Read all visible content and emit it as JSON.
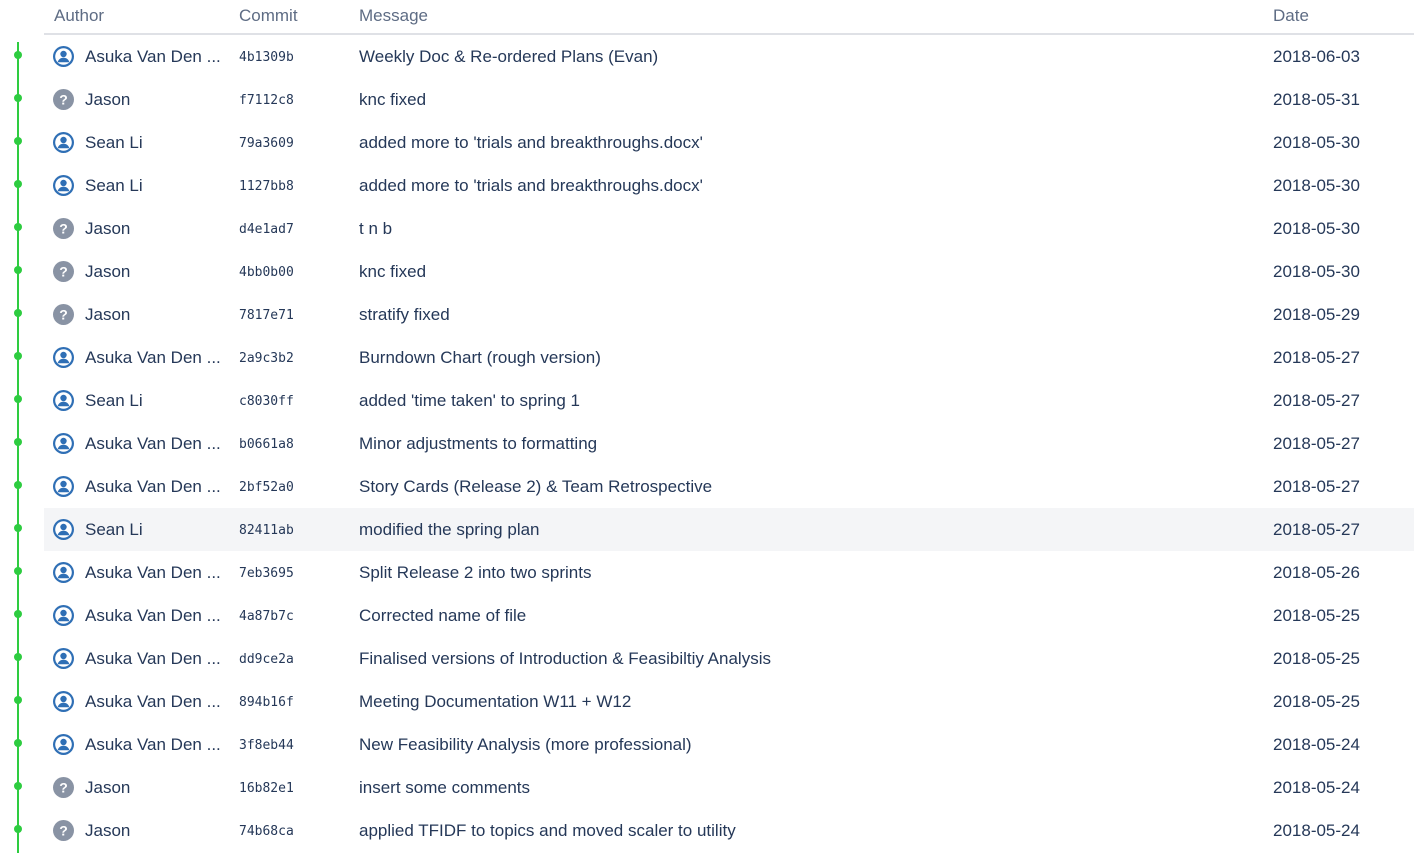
{
  "columns": {
    "author": "Author",
    "commit": "Commit",
    "message": "Message",
    "date": "Date"
  },
  "colors": {
    "graph": "#2ecc40",
    "user_avatar": "#2f6fb5",
    "unknown_avatar": "#8993a4",
    "highlight_row": "#f4f5f7"
  },
  "rows": [
    {
      "author": "Asuka Van Den ...",
      "avatar": "user-avatar-icon",
      "commit": "4b1309b",
      "message": "Weekly Doc & Re-ordered Plans (Evan)",
      "date": "2018-06-03"
    },
    {
      "author": "Jason",
      "avatar": "unknown-user-icon",
      "commit": "f7112c8",
      "message": "knc fixed",
      "date": "2018-05-31"
    },
    {
      "author": "Sean Li",
      "avatar": "user-avatar-icon",
      "commit": "79a3609",
      "message": "added more to 'trials and breakthroughs.docx'",
      "date": "2018-05-30"
    },
    {
      "author": "Sean Li",
      "avatar": "user-avatar-icon",
      "commit": "1127bb8",
      "message": "added more to 'trials and breakthroughs.docx'",
      "date": "2018-05-30"
    },
    {
      "author": "Jason",
      "avatar": "unknown-user-icon",
      "commit": "d4e1ad7",
      "message": "t n b",
      "date": "2018-05-30"
    },
    {
      "author": "Jason",
      "avatar": "unknown-user-icon",
      "commit": "4bb0b00",
      "message": "knc fixed",
      "date": "2018-05-30"
    },
    {
      "author": "Jason",
      "avatar": "unknown-user-icon",
      "commit": "7817e71",
      "message": "stratify fixed",
      "date": "2018-05-29"
    },
    {
      "author": "Asuka Van Den ...",
      "avatar": "user-avatar-icon",
      "commit": "2a9c3b2",
      "message": "Burndown Chart (rough version)",
      "date": "2018-05-27"
    },
    {
      "author": "Sean Li",
      "avatar": "user-avatar-icon",
      "commit": "c8030ff",
      "message": "added 'time taken' to spring 1",
      "date": "2018-05-27"
    },
    {
      "author": "Asuka Van Den ...",
      "avatar": "user-avatar-icon",
      "commit": "b0661a8",
      "message": "Minor adjustments to formatting",
      "date": "2018-05-27"
    },
    {
      "author": "Asuka Van Den ...",
      "avatar": "user-avatar-icon",
      "commit": "2bf52a0",
      "message": "Story Cards (Release 2) & Team Retrospective",
      "date": "2018-05-27"
    },
    {
      "author": "Sean Li",
      "avatar": "user-avatar-icon",
      "commit": "82411ab",
      "message": "modified the spring plan",
      "date": "2018-05-27"
    },
    {
      "author": "Asuka Van Den ...",
      "avatar": "user-avatar-icon",
      "commit": "7eb3695",
      "message": "Split Release 2 into two sprints",
      "date": "2018-05-26"
    },
    {
      "author": "Asuka Van Den ...",
      "avatar": "user-avatar-icon",
      "commit": "4a87b7c",
      "message": "Corrected name of file",
      "date": "2018-05-25"
    },
    {
      "author": "Asuka Van Den ...",
      "avatar": "user-avatar-icon",
      "commit": "dd9ce2a",
      "message": "Finalised versions of Introduction & Feasibiltiy Analysis",
      "date": "2018-05-25"
    },
    {
      "author": "Asuka Van Den ...",
      "avatar": "user-avatar-icon",
      "commit": "894b16f",
      "message": "Meeting Documentation W11 + W12",
      "date": "2018-05-25"
    },
    {
      "author": "Asuka Van Den ...",
      "avatar": "user-avatar-icon",
      "commit": "3f8eb44",
      "message": "New Feasibility Analysis (more professional)",
      "date": "2018-05-24"
    },
    {
      "author": "Jason",
      "avatar": "unknown-user-icon",
      "commit": "16b82e1",
      "message": "insert some comments",
      "date": "2018-05-24"
    },
    {
      "author": "Jason",
      "avatar": "unknown-user-icon",
      "commit": "74b68ca",
      "message": "applied TFIDF to topics and moved scaler to utility",
      "date": "2018-05-24"
    }
  ]
}
